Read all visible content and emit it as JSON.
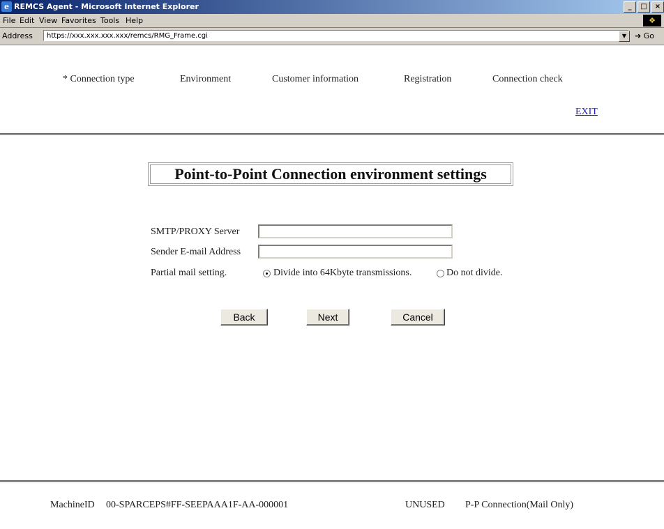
{
  "window": {
    "title": "REMCS Agent - Microsoft Internet Explorer",
    "minimize": "_",
    "maximize": "□",
    "close": "×"
  },
  "menu": [
    "File",
    "Edit",
    "View",
    "Favorites",
    "Tools",
    "Help"
  ],
  "address": {
    "label": "Address",
    "url": "https://xxx.xxx.xxx.xxx/remcs/RMG_Frame.cgi",
    "go_label": "Go"
  },
  "steps": [
    "* Connection type",
    "Environment",
    "Customer information",
    "Registration",
    "Connection check"
  ],
  "exit_label": "EXIT",
  "page_title": "Point-to-Point Connection environment settings",
  "form": {
    "smtp_label": "SMTP/PROXY Server",
    "smtp_value": "",
    "sender_label": "Sender E-mail Address",
    "sender_value": "",
    "partial_label": "Partial mail setting.",
    "option_divide": "Divide into 64Kbyte transmissions.",
    "option_no_divide": "Do not divide.",
    "selected_option": "divide"
  },
  "buttons": {
    "back": "Back",
    "next": "Next",
    "cancel": "Cancel"
  },
  "footer": {
    "machine_label": "MachineID",
    "machine_id": "00-SPARCEPS#FF-SEEPAAA1F-AA-000001",
    "status": "UNUSED",
    "connection": "P-P Connection(Mail Only)"
  }
}
